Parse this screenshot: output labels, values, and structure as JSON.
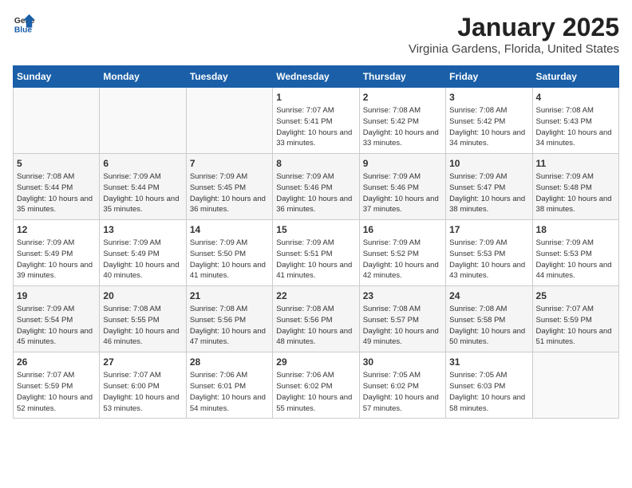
{
  "header": {
    "logo": {
      "line1": "General",
      "line2": "Blue"
    },
    "title": "January 2025",
    "subtitle": "Virginia Gardens, Florida, United States"
  },
  "days_of_week": [
    "Sunday",
    "Monday",
    "Tuesday",
    "Wednesday",
    "Thursday",
    "Friday",
    "Saturday"
  ],
  "weeks": [
    [
      {
        "num": "",
        "sunrise": "",
        "sunset": "",
        "daylight": ""
      },
      {
        "num": "",
        "sunrise": "",
        "sunset": "",
        "daylight": ""
      },
      {
        "num": "",
        "sunrise": "",
        "sunset": "",
        "daylight": ""
      },
      {
        "num": "1",
        "sunrise": "Sunrise: 7:07 AM",
        "sunset": "Sunset: 5:41 PM",
        "daylight": "Daylight: 10 hours and 33 minutes."
      },
      {
        "num": "2",
        "sunrise": "Sunrise: 7:08 AM",
        "sunset": "Sunset: 5:42 PM",
        "daylight": "Daylight: 10 hours and 33 minutes."
      },
      {
        "num": "3",
        "sunrise": "Sunrise: 7:08 AM",
        "sunset": "Sunset: 5:42 PM",
        "daylight": "Daylight: 10 hours and 34 minutes."
      },
      {
        "num": "4",
        "sunrise": "Sunrise: 7:08 AM",
        "sunset": "Sunset: 5:43 PM",
        "daylight": "Daylight: 10 hours and 34 minutes."
      }
    ],
    [
      {
        "num": "5",
        "sunrise": "Sunrise: 7:08 AM",
        "sunset": "Sunset: 5:44 PM",
        "daylight": "Daylight: 10 hours and 35 minutes."
      },
      {
        "num": "6",
        "sunrise": "Sunrise: 7:09 AM",
        "sunset": "Sunset: 5:44 PM",
        "daylight": "Daylight: 10 hours and 35 minutes."
      },
      {
        "num": "7",
        "sunrise": "Sunrise: 7:09 AM",
        "sunset": "Sunset: 5:45 PM",
        "daylight": "Daylight: 10 hours and 36 minutes."
      },
      {
        "num": "8",
        "sunrise": "Sunrise: 7:09 AM",
        "sunset": "Sunset: 5:46 PM",
        "daylight": "Daylight: 10 hours and 36 minutes."
      },
      {
        "num": "9",
        "sunrise": "Sunrise: 7:09 AM",
        "sunset": "Sunset: 5:46 PM",
        "daylight": "Daylight: 10 hours and 37 minutes."
      },
      {
        "num": "10",
        "sunrise": "Sunrise: 7:09 AM",
        "sunset": "Sunset: 5:47 PM",
        "daylight": "Daylight: 10 hours and 38 minutes."
      },
      {
        "num": "11",
        "sunrise": "Sunrise: 7:09 AM",
        "sunset": "Sunset: 5:48 PM",
        "daylight": "Daylight: 10 hours and 38 minutes."
      }
    ],
    [
      {
        "num": "12",
        "sunrise": "Sunrise: 7:09 AM",
        "sunset": "Sunset: 5:49 PM",
        "daylight": "Daylight: 10 hours and 39 minutes."
      },
      {
        "num": "13",
        "sunrise": "Sunrise: 7:09 AM",
        "sunset": "Sunset: 5:49 PM",
        "daylight": "Daylight: 10 hours and 40 minutes."
      },
      {
        "num": "14",
        "sunrise": "Sunrise: 7:09 AM",
        "sunset": "Sunset: 5:50 PM",
        "daylight": "Daylight: 10 hours and 41 minutes."
      },
      {
        "num": "15",
        "sunrise": "Sunrise: 7:09 AM",
        "sunset": "Sunset: 5:51 PM",
        "daylight": "Daylight: 10 hours and 41 minutes."
      },
      {
        "num": "16",
        "sunrise": "Sunrise: 7:09 AM",
        "sunset": "Sunset: 5:52 PM",
        "daylight": "Daylight: 10 hours and 42 minutes."
      },
      {
        "num": "17",
        "sunrise": "Sunrise: 7:09 AM",
        "sunset": "Sunset: 5:53 PM",
        "daylight": "Daylight: 10 hours and 43 minutes."
      },
      {
        "num": "18",
        "sunrise": "Sunrise: 7:09 AM",
        "sunset": "Sunset: 5:53 PM",
        "daylight": "Daylight: 10 hours and 44 minutes."
      }
    ],
    [
      {
        "num": "19",
        "sunrise": "Sunrise: 7:09 AM",
        "sunset": "Sunset: 5:54 PM",
        "daylight": "Daylight: 10 hours and 45 minutes."
      },
      {
        "num": "20",
        "sunrise": "Sunrise: 7:08 AM",
        "sunset": "Sunset: 5:55 PM",
        "daylight": "Daylight: 10 hours and 46 minutes."
      },
      {
        "num": "21",
        "sunrise": "Sunrise: 7:08 AM",
        "sunset": "Sunset: 5:56 PM",
        "daylight": "Daylight: 10 hours and 47 minutes."
      },
      {
        "num": "22",
        "sunrise": "Sunrise: 7:08 AM",
        "sunset": "Sunset: 5:56 PM",
        "daylight": "Daylight: 10 hours and 48 minutes."
      },
      {
        "num": "23",
        "sunrise": "Sunrise: 7:08 AM",
        "sunset": "Sunset: 5:57 PM",
        "daylight": "Daylight: 10 hours and 49 minutes."
      },
      {
        "num": "24",
        "sunrise": "Sunrise: 7:08 AM",
        "sunset": "Sunset: 5:58 PM",
        "daylight": "Daylight: 10 hours and 50 minutes."
      },
      {
        "num": "25",
        "sunrise": "Sunrise: 7:07 AM",
        "sunset": "Sunset: 5:59 PM",
        "daylight": "Daylight: 10 hours and 51 minutes."
      }
    ],
    [
      {
        "num": "26",
        "sunrise": "Sunrise: 7:07 AM",
        "sunset": "Sunset: 5:59 PM",
        "daylight": "Daylight: 10 hours and 52 minutes."
      },
      {
        "num": "27",
        "sunrise": "Sunrise: 7:07 AM",
        "sunset": "Sunset: 6:00 PM",
        "daylight": "Daylight: 10 hours and 53 minutes."
      },
      {
        "num": "28",
        "sunrise": "Sunrise: 7:06 AM",
        "sunset": "Sunset: 6:01 PM",
        "daylight": "Daylight: 10 hours and 54 minutes."
      },
      {
        "num": "29",
        "sunrise": "Sunrise: 7:06 AM",
        "sunset": "Sunset: 6:02 PM",
        "daylight": "Daylight: 10 hours and 55 minutes."
      },
      {
        "num": "30",
        "sunrise": "Sunrise: 7:05 AM",
        "sunset": "Sunset: 6:02 PM",
        "daylight": "Daylight: 10 hours and 57 minutes."
      },
      {
        "num": "31",
        "sunrise": "Sunrise: 7:05 AM",
        "sunset": "Sunset: 6:03 PM",
        "daylight": "Daylight: 10 hours and 58 minutes."
      },
      {
        "num": "",
        "sunrise": "",
        "sunset": "",
        "daylight": ""
      }
    ]
  ]
}
